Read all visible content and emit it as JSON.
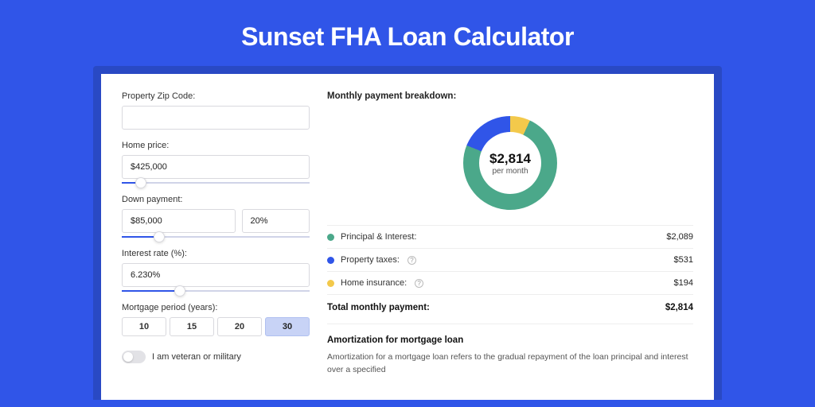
{
  "colors": {
    "brand": "#3055e8",
    "green": "#4ba88a",
    "yellow": "#f3c94b"
  },
  "title": "Sunset FHA Loan Calculator",
  "form": {
    "zip_label": "Property Zip Code:",
    "zip_value": "",
    "home_price_label": "Home price:",
    "home_price_value": "$425,000",
    "down_payment_label": "Down payment:",
    "down_payment_value": "$85,000",
    "down_payment_pct": "20%",
    "interest_label": "Interest rate (%):",
    "interest_value": "6.230%",
    "period_label": "Mortgage period (years):",
    "period_options": [
      "10",
      "15",
      "20",
      "30"
    ],
    "period_selected": "30",
    "veteran_label": "I am veteran or military",
    "veteran_on": false
  },
  "breakdown": {
    "title": "Monthly payment breakdown:",
    "center_amount": "$2,814",
    "center_sub": "per month",
    "rows": [
      {
        "color": "green",
        "label": "Principal & Interest:",
        "info": false,
        "value": "$2,089"
      },
      {
        "color": "blue",
        "label": "Property taxes:",
        "info": true,
        "value": "$531"
      },
      {
        "color": "yellow",
        "label": "Home insurance:",
        "info": true,
        "value": "$194"
      }
    ],
    "total_label": "Total monthly payment:",
    "total_value": "$2,814"
  },
  "amortization": {
    "title": "Amortization for mortgage loan",
    "body": "Amortization for a mortgage loan refers to the gradual repayment of the loan principal and interest over a specified"
  },
  "chart_data": {
    "type": "pie",
    "title": "Monthly payment breakdown",
    "series": [
      {
        "name": "Principal & Interest",
        "value": 2089,
        "color": "#4ba88a"
      },
      {
        "name": "Property taxes",
        "value": 531,
        "color": "#3055e8"
      },
      {
        "name": "Home insurance",
        "value": 194,
        "color": "#f3c94b"
      }
    ],
    "total": 2814,
    "center_label": "$2,814 per month"
  }
}
